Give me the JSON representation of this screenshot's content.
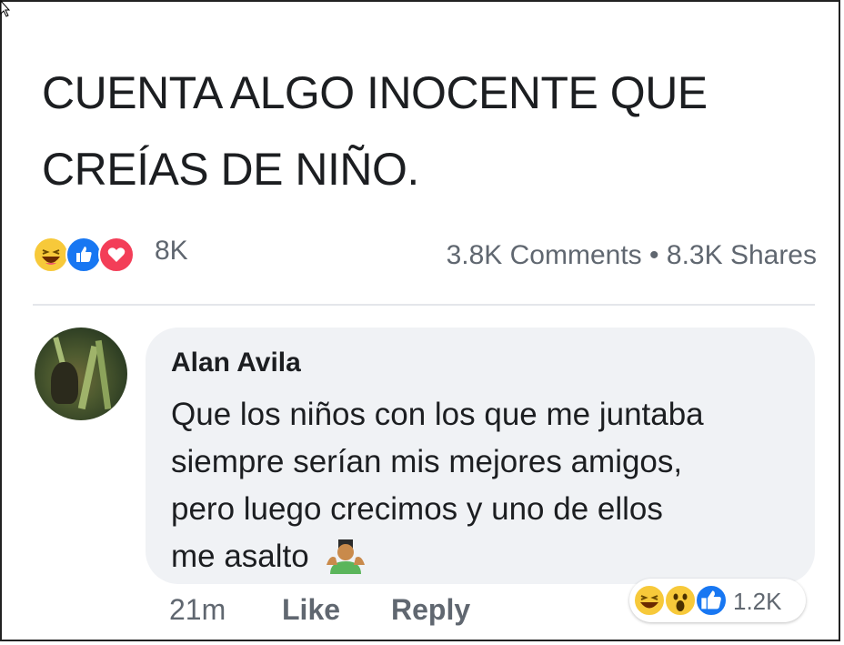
{
  "post": {
    "line1": "CUENTA ALGO INOCENTE QUE",
    "line2": "CREÍAS DE NIÑO."
  },
  "stats": {
    "reaction_count": "8K",
    "comments": "3.8K Comments",
    "separator": "•",
    "shares": "8.3K Shares",
    "reaction_icons": [
      "haha-icon",
      "like-icon",
      "love-icon"
    ]
  },
  "comment": {
    "author": "Alan Avila",
    "line1": "Que los niños con los que me juntaba",
    "line2": "siempre serían mis mejores amigos,",
    "line3": "pero luego crecimos y uno de ellos",
    "line4": "me asalto",
    "emoji": "man-raising-hands-emoji",
    "time": "21m",
    "like_label": "Like",
    "reply_label": "Reply",
    "reaction_count": "1.2K",
    "reaction_icons": [
      "haha-icon",
      "wow-icon",
      "like-icon"
    ]
  },
  "colors": {
    "like_blue": "#1877f2",
    "love_red": "#f33e58",
    "haha_yellow": "#f7c93a",
    "meta_gray": "#606770",
    "bubble_bg": "#f0f2f5"
  }
}
